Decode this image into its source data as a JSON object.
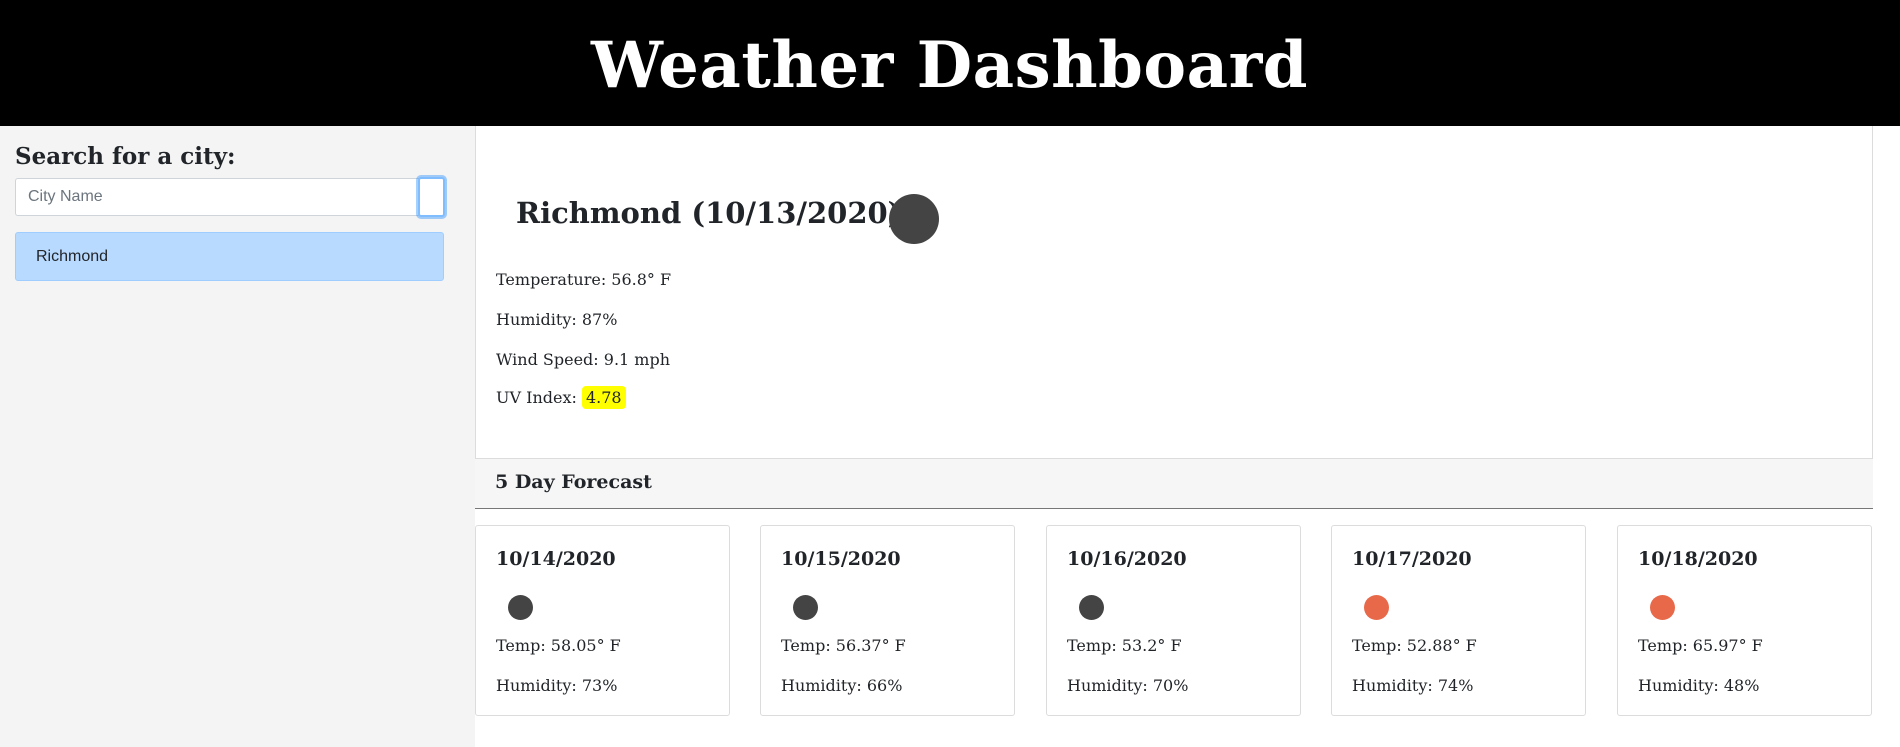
{
  "header": {
    "title": "Weather Dashboard"
  },
  "sidebar": {
    "heading": "Search for a city:",
    "search_placeholder": "City Name",
    "search_value": "",
    "history": [
      "Richmond"
    ]
  },
  "current": {
    "title": "Richmond (10/13/2020)",
    "icon": "weather-icon",
    "temperature": "Temperature: 56.8° F",
    "humidity": "Humidity: 87%",
    "wind": "Wind Speed: 9.1 mph",
    "uv_label": "UV Index: ",
    "uv_value": "4.78",
    "uv_color": "#ffff00"
  },
  "forecast": {
    "heading": "5 Day Forecast",
    "days": [
      {
        "date": "10/14/2020",
        "temp": "Temp: 58.05° F",
        "humidity": "Humidity: 73%",
        "icon_color": "#444444"
      },
      {
        "date": "10/15/2020",
        "temp": "Temp: 56.37° F",
        "humidity": "Humidity: 66%",
        "icon_color": "#444444"
      },
      {
        "date": "10/16/2020",
        "temp": "Temp: 53.2° F",
        "humidity": "Humidity: 70%",
        "icon_color": "#444444"
      },
      {
        "date": "10/17/2020",
        "temp": "Temp: 52.88° F",
        "humidity": "Humidity: 74%",
        "icon_color": "#e8694a"
      },
      {
        "date": "10/18/2020",
        "temp": "Temp: 65.97° F",
        "humidity": "Humidity: 48%",
        "icon_color": "#e8694a"
      }
    ]
  }
}
